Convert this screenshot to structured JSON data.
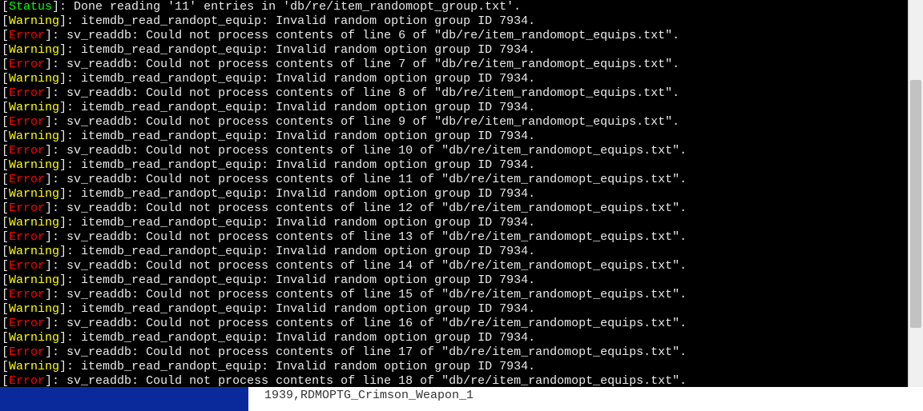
{
  "labels": {
    "status": "Status",
    "warning": "Warning",
    "error": "Error"
  },
  "status_msg": ": Done reading '11' entries in 'db/re/item_randomopt_group.txt'.",
  "warn_msg": ": itemdb_read_randopt_equip: Invalid random option group ID 7934.",
  "err_prefix": ": sv_readdb: Could not process contents of line ",
  "err_suffix": " of \"db/re/item_randomopt_equips.txt\".",
  "err_lines": [
    6,
    7,
    8,
    9,
    10,
    11,
    12,
    13,
    14,
    15,
    16,
    17,
    18
  ],
  "footer_text": "1939,RDMOPTG_Crimson_Weapon_1"
}
